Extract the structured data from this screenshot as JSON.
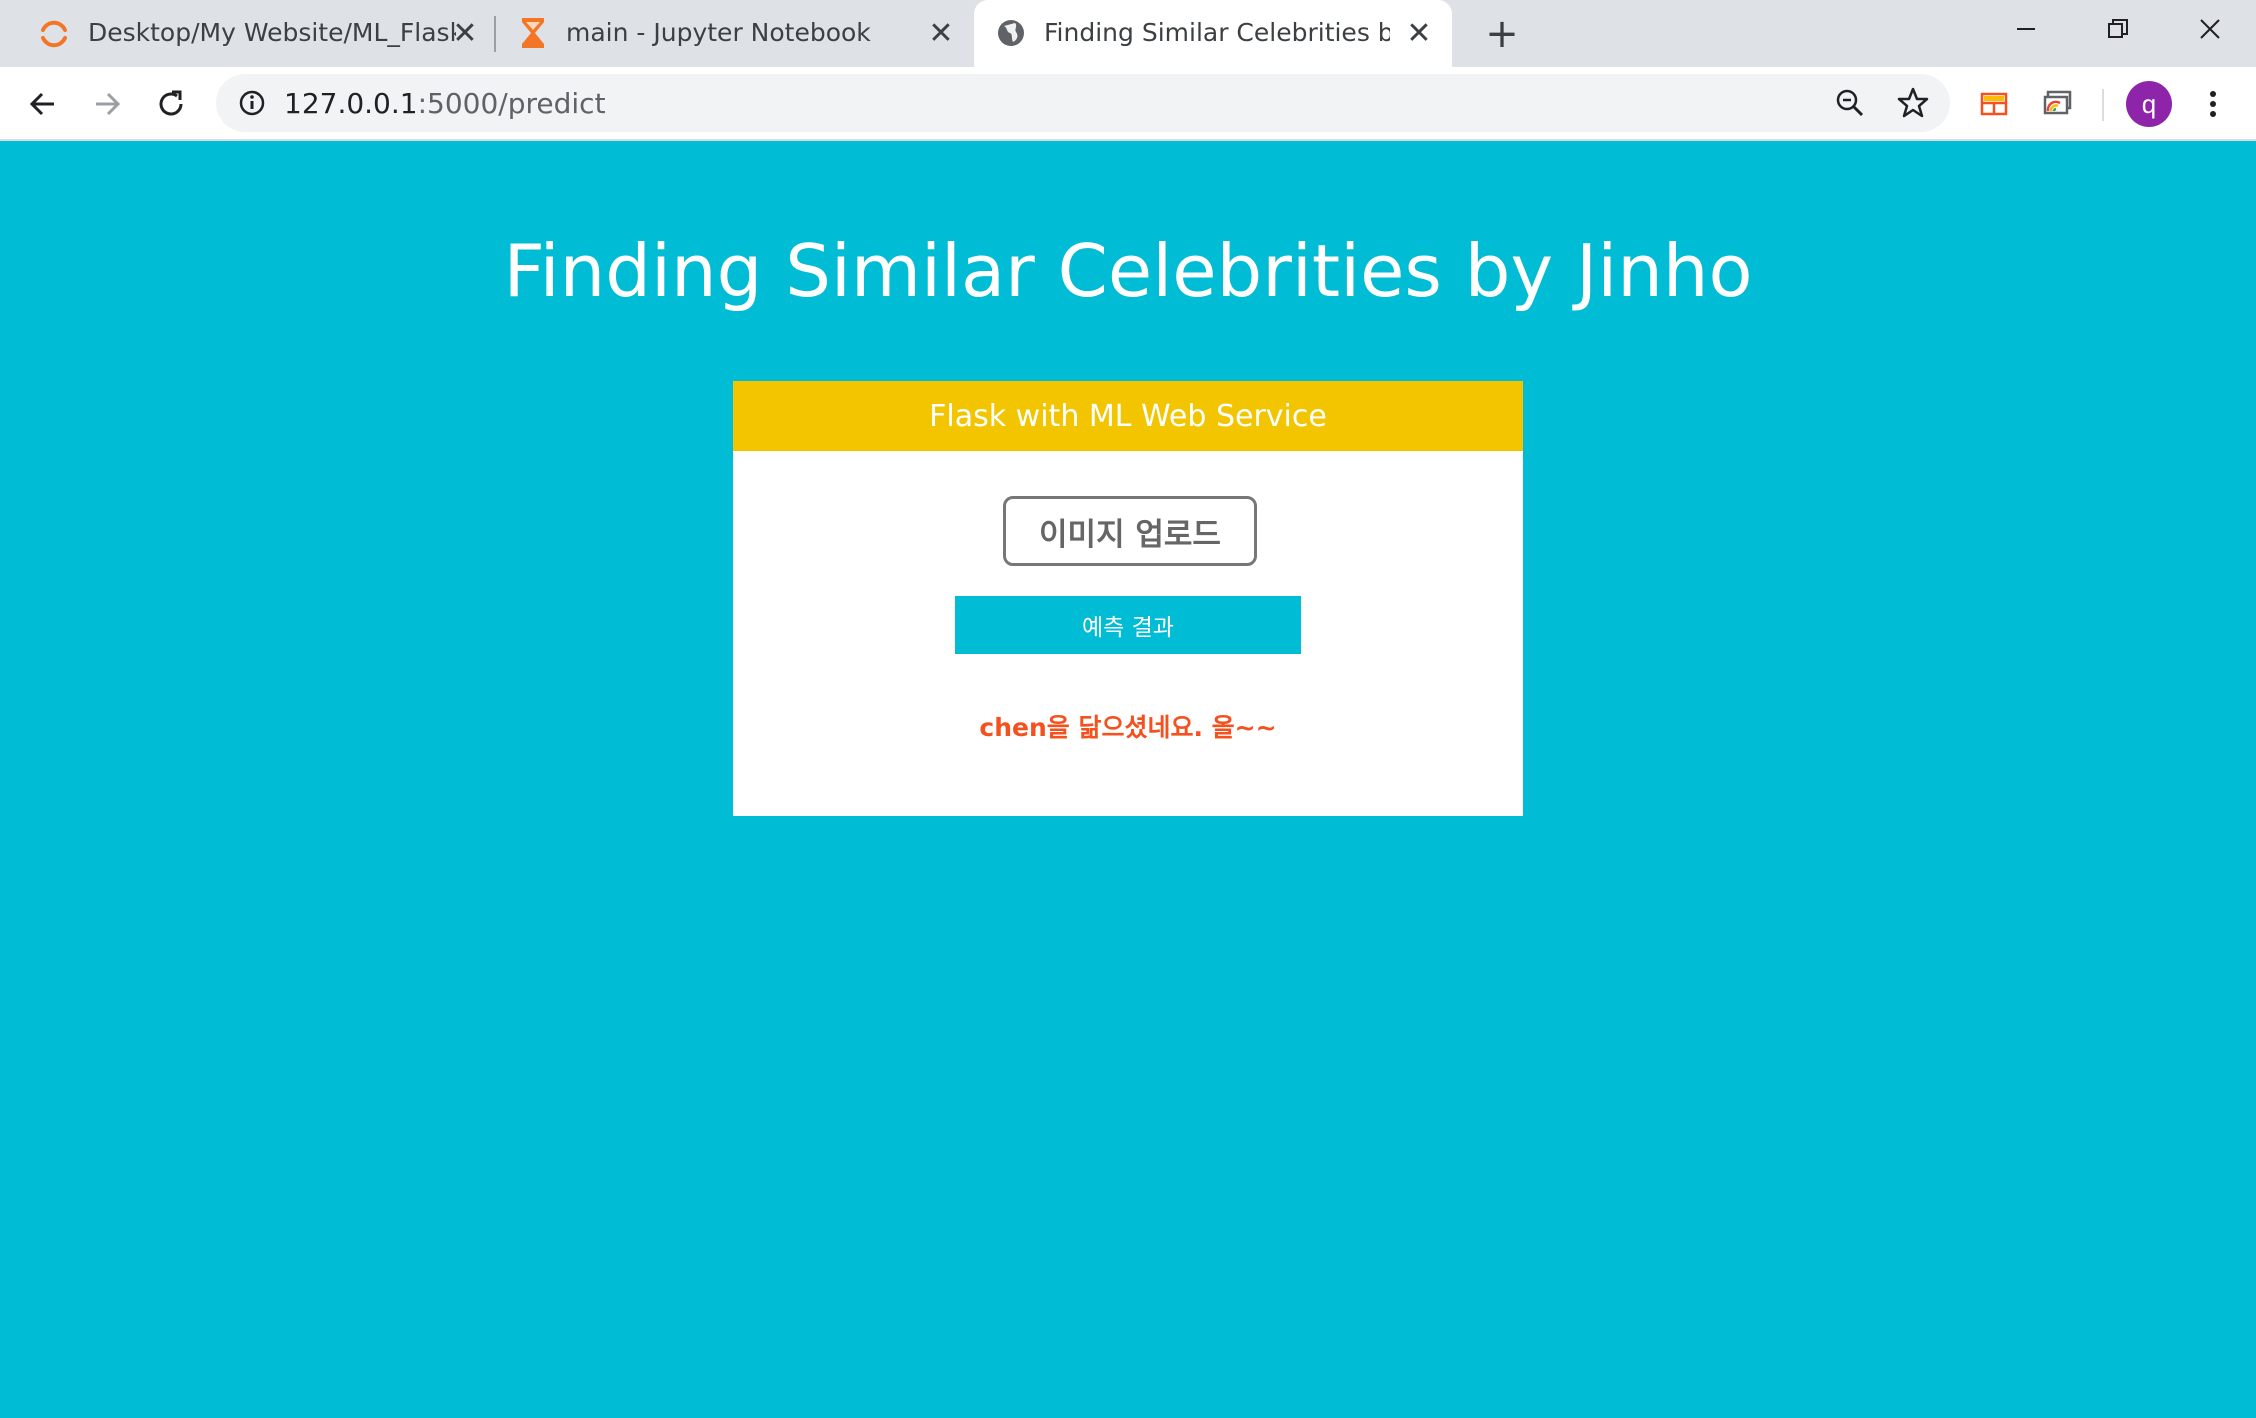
{
  "browser": {
    "tabs": [
      {
        "title": "Desktop/My Website/ML_Flask_",
        "icon": "loading-spinner-icon",
        "active": false
      },
      {
        "title": "main - Jupyter Notebook",
        "icon": "hourglass-icon",
        "active": false
      },
      {
        "title": "Finding Similar Celebrities by Jin",
        "icon": "globe-icon",
        "active": true
      }
    ],
    "address_bar": {
      "host": "127.0.0.1",
      "rest": ":5000/predict"
    },
    "profile_initial": "q"
  },
  "page": {
    "title": "Finding Similar Celebrities by Jinho",
    "card": {
      "header": "Flask with ML Web Service",
      "upload_label": "이미지 업로드",
      "predict_label": "예측 결과",
      "result_text": "chen을 닮으셨네요. 올~~"
    }
  },
  "colors": {
    "background": "#00bcd4",
    "card_header": "#f2c500",
    "result": "#f4511e",
    "avatar": "#8e24aa"
  }
}
